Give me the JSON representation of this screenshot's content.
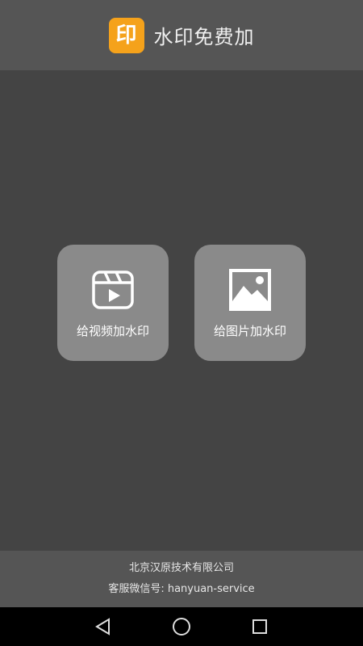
{
  "header": {
    "logo_char": "印",
    "title": "水印免费加",
    "logo_color": "#f5a21b"
  },
  "main": {
    "buttons": [
      {
        "label": "给视频加水印",
        "icon": "video-clapper-icon"
      },
      {
        "label": "给图片加水印",
        "icon": "image-icon"
      }
    ]
  },
  "footer": {
    "company": "北京汉原技术有限公司",
    "contact": "客服微信号: hanyuan-service"
  },
  "navbar": {
    "buttons": [
      "back-icon",
      "home-icon",
      "recents-icon"
    ]
  }
}
